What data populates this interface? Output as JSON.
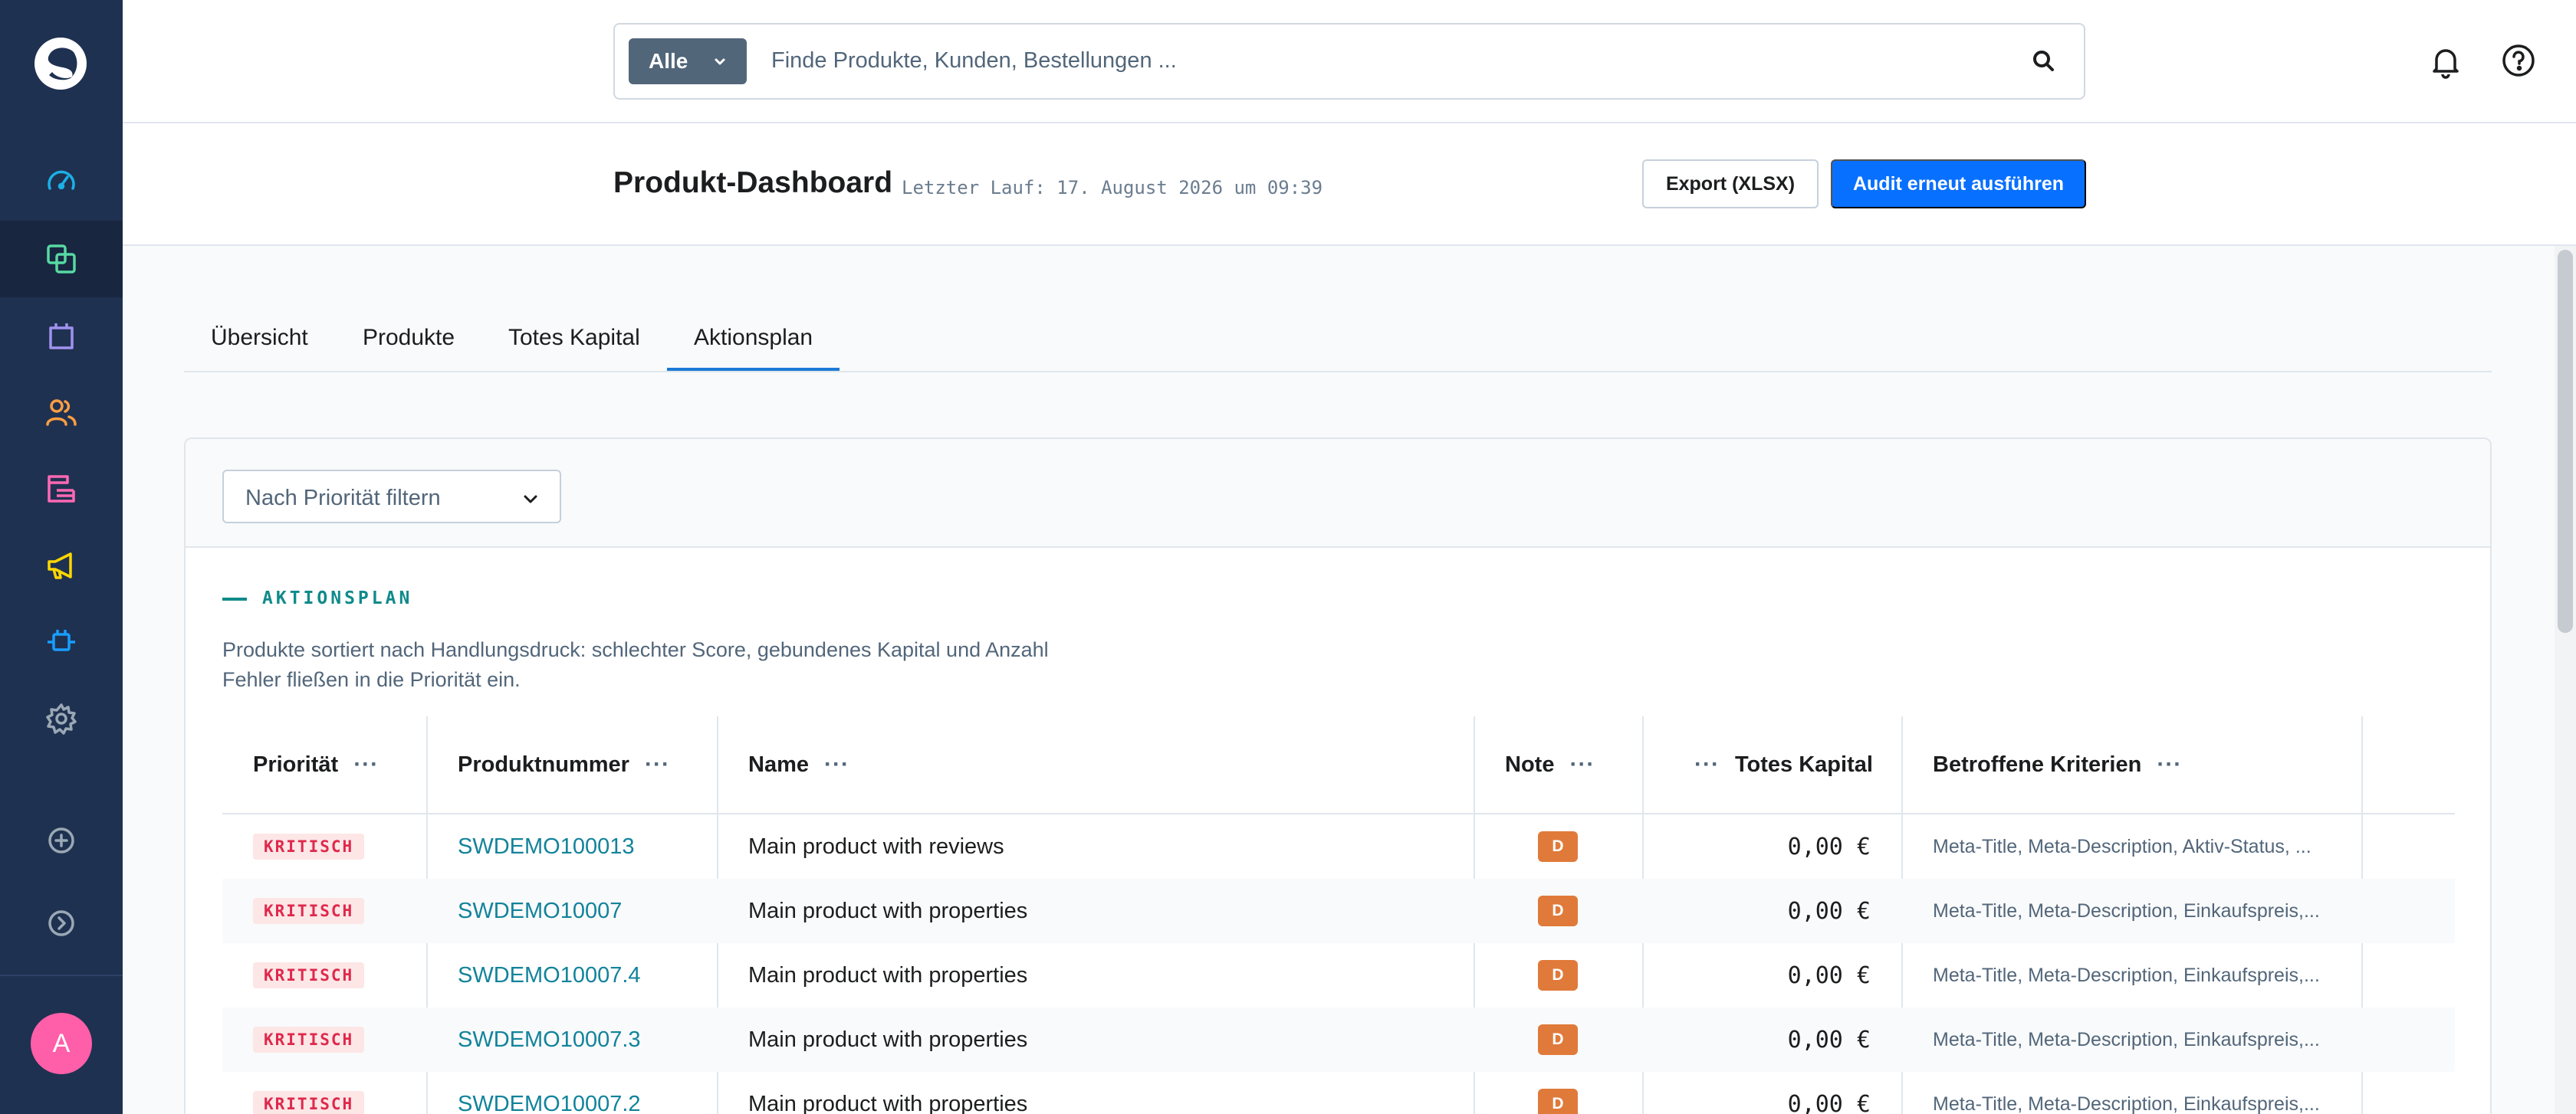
{
  "sidebar": {
    "items": [
      {
        "icon": "dashboard-icon",
        "color": "#1bb0e6"
      },
      {
        "icon": "catalogue-icon",
        "color": "#57d9a3",
        "active": true
      },
      {
        "icon": "orders-icon",
        "color": "#a092f0"
      },
      {
        "icon": "customers-icon",
        "color": "#ff9e42"
      },
      {
        "icon": "content-icon",
        "color": "#ff68b4"
      },
      {
        "icon": "marketing-icon",
        "color": "#ffd700"
      },
      {
        "icon": "extensions-icon",
        "color": "#189eff"
      },
      {
        "icon": "settings-icon",
        "color": "#9aa8b5"
      },
      {
        "icon": "add-icon",
        "color": "#9aa8b5"
      },
      {
        "icon": "collapse-icon",
        "color": "#9aa8b5"
      }
    ],
    "avatar_letter": "A"
  },
  "search": {
    "type_label": "Alle",
    "placeholder": "Finde Produkte, Kunden, Bestellungen ..."
  },
  "page": {
    "title": "Produkt-Dashboard",
    "last_run": "Letzter Lauf: 17. August 2026 um 09:39",
    "export_label": "Export (XLSX)",
    "audit_label": "Audit erneut ausführen"
  },
  "tabs": [
    {
      "label": "Übersicht"
    },
    {
      "label": "Produkte"
    },
    {
      "label": "Totes Kapital"
    },
    {
      "label": "Aktionsplan",
      "active": true
    }
  ],
  "filter": {
    "placeholder": "Nach Priorität filtern"
  },
  "section": {
    "label": "AKTIONSPLAN",
    "description": "Produkte sortiert nach Handlungsdruck: schlechter Score, gebundenes Kapital und Anzahl Fehler fließen in die Priorität ein."
  },
  "table": {
    "headers": {
      "priority": "Priorität",
      "number": "Produktnummer",
      "name": "Name",
      "grade": "Note",
      "capital": "Totes Kapital",
      "criteria": "Betroffene Kriterien"
    },
    "dots": "···",
    "rows": [
      {
        "priority": "KRITISCH",
        "number": "SWDEMO100013",
        "name": "Main product with reviews",
        "grade": "D",
        "capital": "0,00 €",
        "criteria": "Meta-Title, Meta-Description, Aktiv-Status, ..."
      },
      {
        "priority": "KRITISCH",
        "number": "SWDEMO10007",
        "name": "Main product with properties",
        "grade": "D",
        "capital": "0,00 €",
        "criteria": "Meta-Title, Meta-Description, Einkaufspreis,..."
      },
      {
        "priority": "KRITISCH",
        "number": "SWDEMO10007.4",
        "name": "Main product with properties",
        "grade": "D",
        "capital": "0,00 €",
        "criteria": "Meta-Title, Meta-Description, Einkaufspreis,..."
      },
      {
        "priority": "KRITISCH",
        "number": "SWDEMO10007.3",
        "name": "Main product with properties",
        "grade": "D",
        "capital": "0,00 €",
        "criteria": "Meta-Title, Meta-Description, Einkaufspreis,..."
      },
      {
        "priority": "KRITISCH",
        "number": "SWDEMO10007.2",
        "name": "Main product with properties",
        "grade": "D",
        "capital": "0,00 €",
        "criteria": "Meta-Title, Meta-Description, Einkaufspreis,..."
      }
    ]
  },
  "colors": {
    "sidebar_bg": "#1f3150",
    "primary": "#0870ff",
    "teal": "#0f8a8a",
    "critical": "#de294c",
    "grade_d": "#e07a3a"
  }
}
